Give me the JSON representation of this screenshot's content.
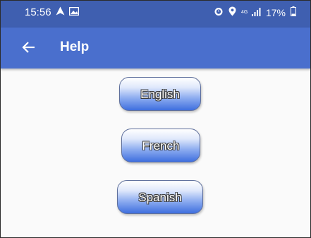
{
  "status_bar": {
    "time": "15:56",
    "network_type": "4G",
    "battery": "17%",
    "icons": [
      "navigation-icon",
      "image-icon",
      "alarm-icon",
      "location-icon",
      "signal-icon",
      "battery-icon"
    ]
  },
  "app_bar": {
    "title": "Help",
    "background_color": "#4a6fcd"
  },
  "buttons": [
    {
      "label": "English"
    },
    {
      "label": "French"
    },
    {
      "label": "Spanish"
    }
  ],
  "colors": {
    "status_bar": "#3f5fb0",
    "button_bottom": "#3f6fdf",
    "button_top": "#ffffff"
  }
}
